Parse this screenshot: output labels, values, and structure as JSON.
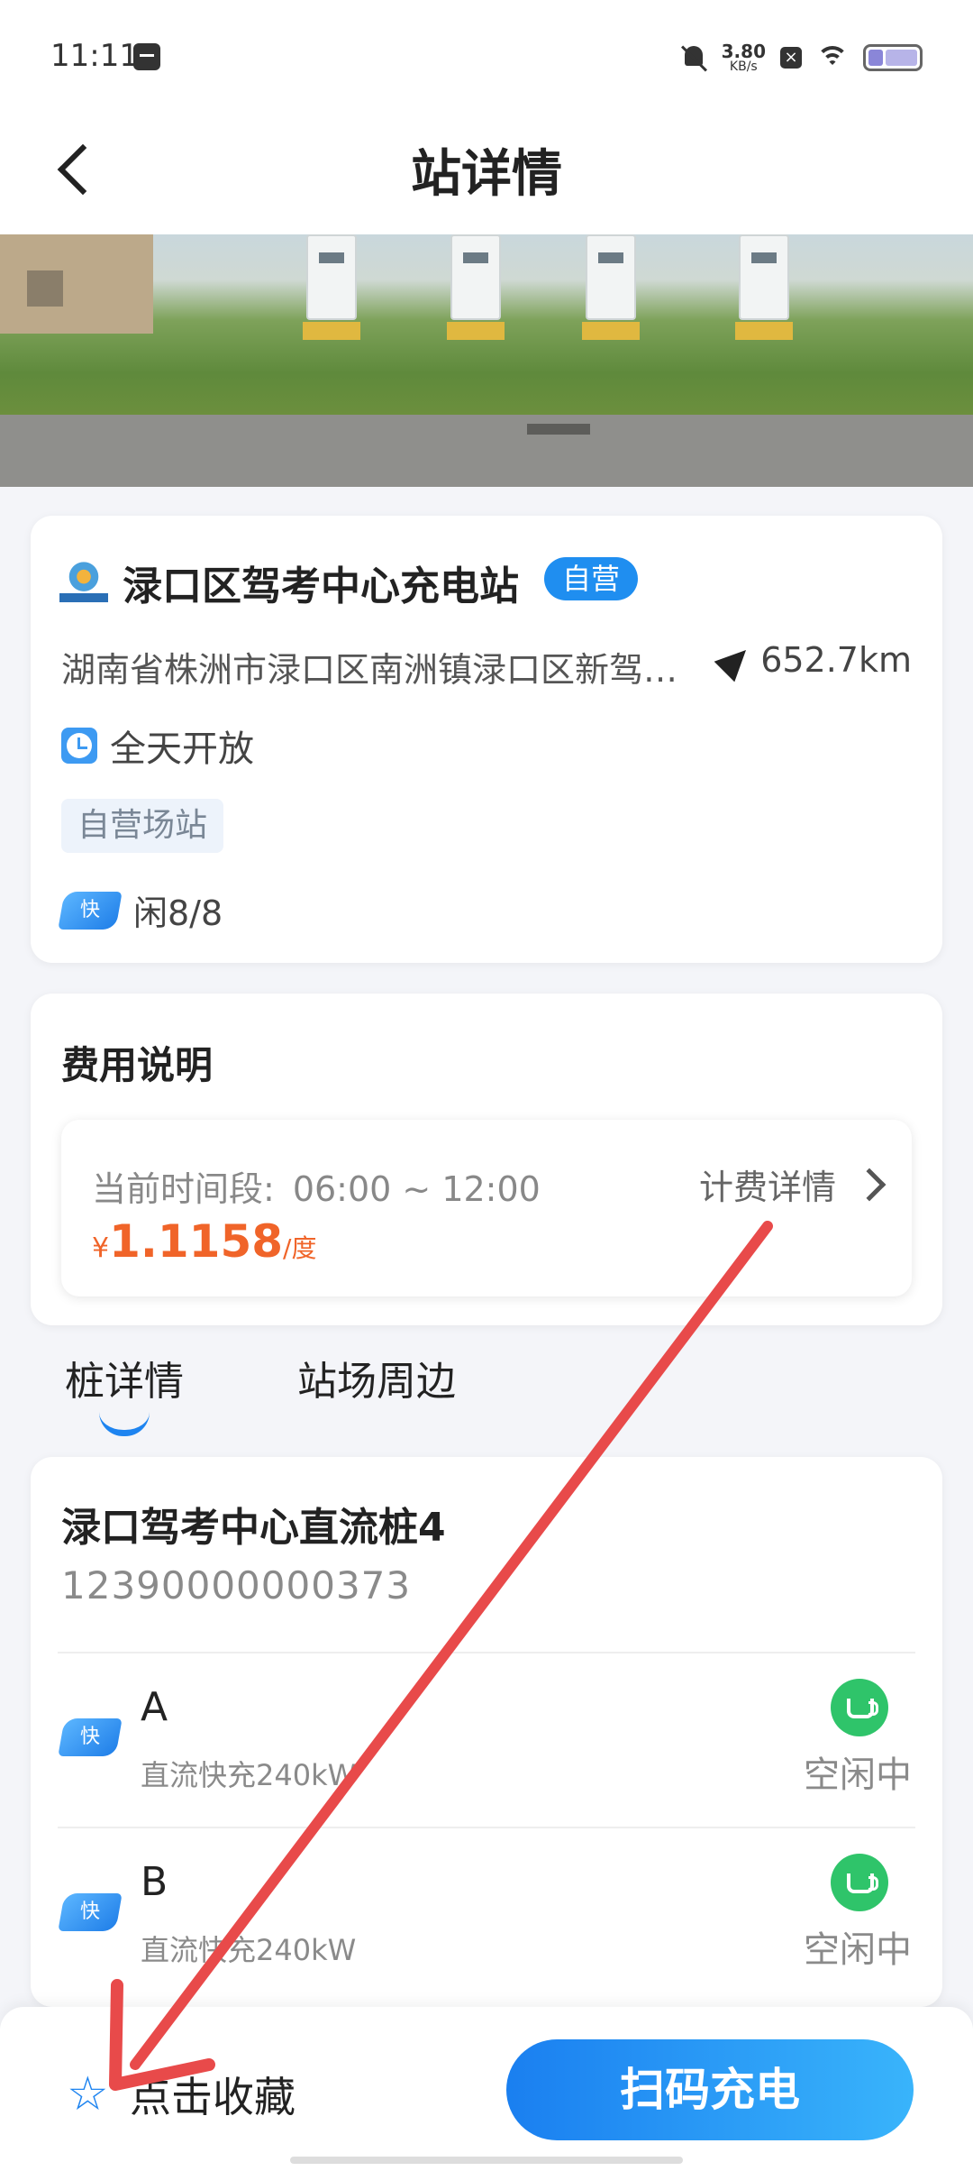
{
  "status_bar": {
    "time": "11:11",
    "net_speed": "3.80",
    "net_unit": "KB/s",
    "x_icon": "×"
  },
  "header": {
    "title": "站详情"
  },
  "station": {
    "name": "渌口区驾考中心充电站",
    "badge": "自营",
    "address": "湖南省株洲市渌口区南洲镇渌口区新驾…",
    "distance": "652.7km",
    "hours": "全天开放",
    "tag": "自营场站",
    "fast_label": "快",
    "idle": "闲8/8"
  },
  "fee": {
    "title": "费用说明",
    "period_label": "当前时间段:",
    "period": "06:00 ~ 12:00",
    "detail_link": "计费详情",
    "currency": "¥",
    "price": "1.1158",
    "unit": "/度"
  },
  "tabs": [
    {
      "label": "桩详情",
      "active": true
    },
    {
      "label": "站场周边",
      "active": false
    }
  ],
  "pile": {
    "name": "渌口驾考中心直流桩4",
    "number": "12390000000373",
    "guns": [
      {
        "fast_label": "快",
        "name": "A",
        "desc": "直流快充240kW",
        "state": "空闲中"
      },
      {
        "fast_label": "快",
        "name": "B",
        "desc": "直流快充240kW",
        "state": "空闲中"
      }
    ]
  },
  "bottom": {
    "favorite": "点击收藏",
    "scan": "扫码充电",
    "star_icon": "☆"
  },
  "colors": {
    "accent": "#1e84f0",
    "price": "#f06429",
    "idle_green": "#2fc46a",
    "annotation_red": "#e84a4a"
  }
}
